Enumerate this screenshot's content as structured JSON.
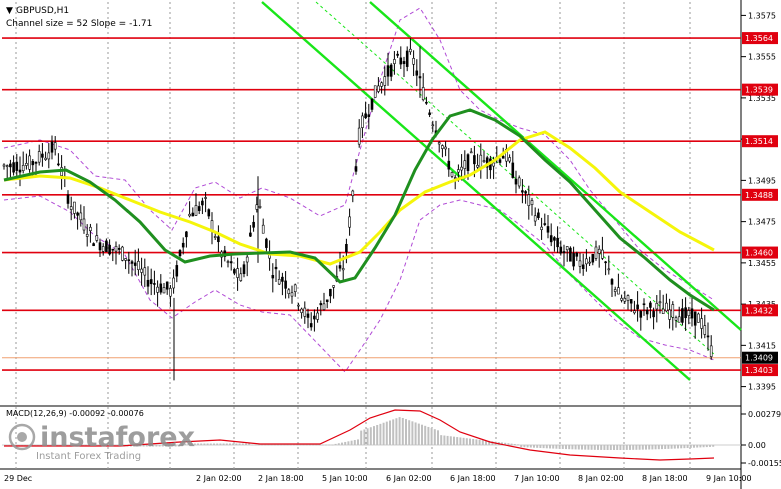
{
  "symbol_title": "GBPUSD,H1",
  "channel_label": "Channel size = 52 Slope = -1.71",
  "macd_label": "MACD(12,26,9) -0.00092 -0.00076",
  "watermark": {
    "brand": "instaforex",
    "tagline": "Instant Forex Trading"
  },
  "colors": {
    "level_line": "#e0000f",
    "channel": "#19e619",
    "ma_fast": "#1f8f1f",
    "ma_slow": "#f5f50a",
    "bands": "#b14bd6",
    "candles": "#000000",
    "macd_hist": "#c0c0c0",
    "macd_signal": "#e0000f"
  },
  "chart_data": {
    "type": "candlestick",
    "symbol": "GBPUSD",
    "timeframe": "H1",
    "price_axis": {
      "ticks": [
        "1.3575",
        "1.3555",
        "1.3535",
        "1.3515",
        "1.3495",
        "1.3475",
        "1.3455",
        "1.3435",
        "1.3415",
        "1.3395"
      ],
      "range": [
        1.339,
        1.358
      ]
    },
    "levels": [
      {
        "label": "1.3564",
        "value": 1.3564
      },
      {
        "label": "1.3539",
        "value": 1.3539
      },
      {
        "label": "1.3514",
        "value": 1.3514
      },
      {
        "label": "1.3488",
        "value": 1.3488
      },
      {
        "label": "1.3460",
        "value": 1.346
      },
      {
        "label": "1.3432",
        "value": 1.3432
      },
      {
        "label": "1.3403",
        "value": 1.3403
      }
    ],
    "current_price": {
      "label": "1.3409",
      "value": 1.3409
    },
    "time_axis": [
      "29 Dec",
      "2 Jan 02:00",
      "2 Jan 18:00",
      "5 Jan 10:00",
      "6 Jan 02:00",
      "6 Jan 18:00",
      "7 Jan 10:00",
      "8 Jan 02:00",
      "8 Jan 18:00",
      "9 Jan 10:00"
    ],
    "macd": {
      "params": "12,26,9",
      "value": -0.00092,
      "signal": -0.00076,
      "ticks": [
        "0.00279",
        "0.00",
        "-0.00155"
      ]
    }
  }
}
